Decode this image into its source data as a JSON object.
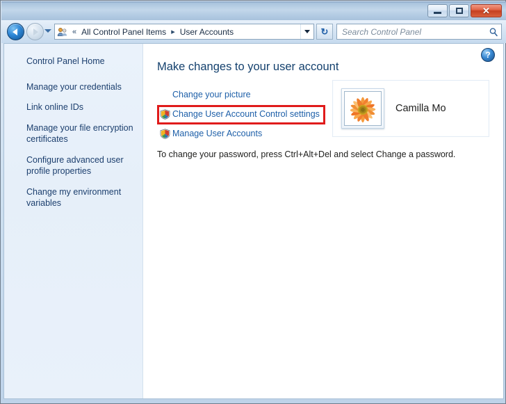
{
  "window": {
    "titlebar": {
      "minimize_label": "Minimize",
      "maximize_label": "Maximize",
      "close_label": "✕"
    }
  },
  "navbar": {
    "back_label": "Back",
    "forward_label": "Forward",
    "history_label": "Recent pages",
    "address_icon": "user-accounts-icon",
    "breadcrumb_chevron": "«",
    "crumb_1": "All Control Panel Items",
    "crumb_sep": "▸",
    "crumb_2": "User Accounts",
    "dropdown_label": "Previous locations",
    "refresh_icon": "↻",
    "refresh_label": "Refresh",
    "search_placeholder": "Search Control Panel",
    "search_value": "",
    "search_icon": "search-icon"
  },
  "sidebar": {
    "home": "Control Panel Home",
    "items": [
      {
        "label": "Manage your credentials"
      },
      {
        "label": "Link online IDs"
      },
      {
        "label": "Manage your file encryption certificates"
      },
      {
        "label": "Configure advanced user profile properties"
      },
      {
        "label": "Change my environment variables"
      }
    ]
  },
  "main": {
    "help_glyph": "?",
    "help_label": "Help",
    "title": "Make changes to your user account",
    "links": [
      {
        "label": "Change your picture",
        "shield": false
      },
      {
        "label": "Change User Account Control settings",
        "shield": true,
        "highlighted": true
      },
      {
        "label": "Manage User Accounts",
        "shield": true
      }
    ],
    "account": {
      "avatar_name": "flower-avatar",
      "user_name": "Camilla Mo"
    },
    "password_note": "To change your password, press Ctrl+Alt+Del and select Change a password."
  },
  "colors": {
    "link": "#1d5fa8",
    "title": "#14416e",
    "highlight": "#e01b1b",
    "sidebar_link": "#1c3f6e"
  }
}
